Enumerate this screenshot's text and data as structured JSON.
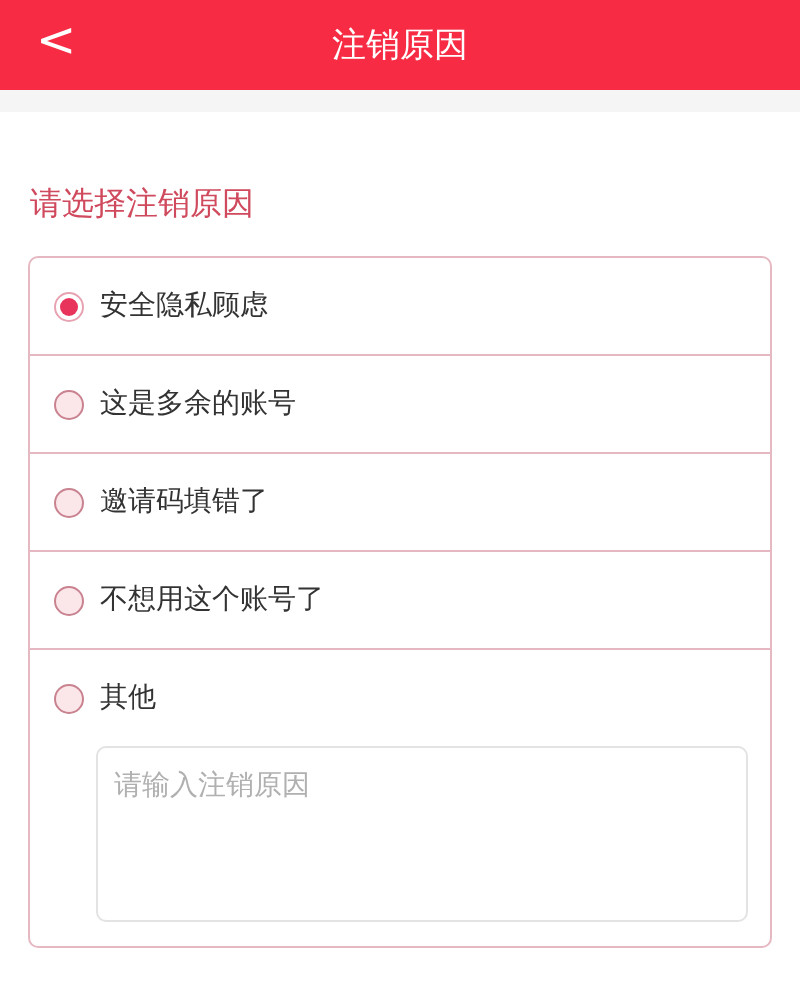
{
  "header": {
    "back": "<",
    "title": "注销原因"
  },
  "section_title": "请选择注销原因",
  "reasons": [
    {
      "label": "安全隐私顾虑",
      "selected": true
    },
    {
      "label": "这是多余的账号",
      "selected": false
    },
    {
      "label": "邀请码填错了",
      "selected": false
    },
    {
      "label": "不想用这个账号了",
      "selected": false
    },
    {
      "label": "其他",
      "selected": false
    }
  ],
  "other_input": {
    "placeholder": "请输入注销原因"
  }
}
